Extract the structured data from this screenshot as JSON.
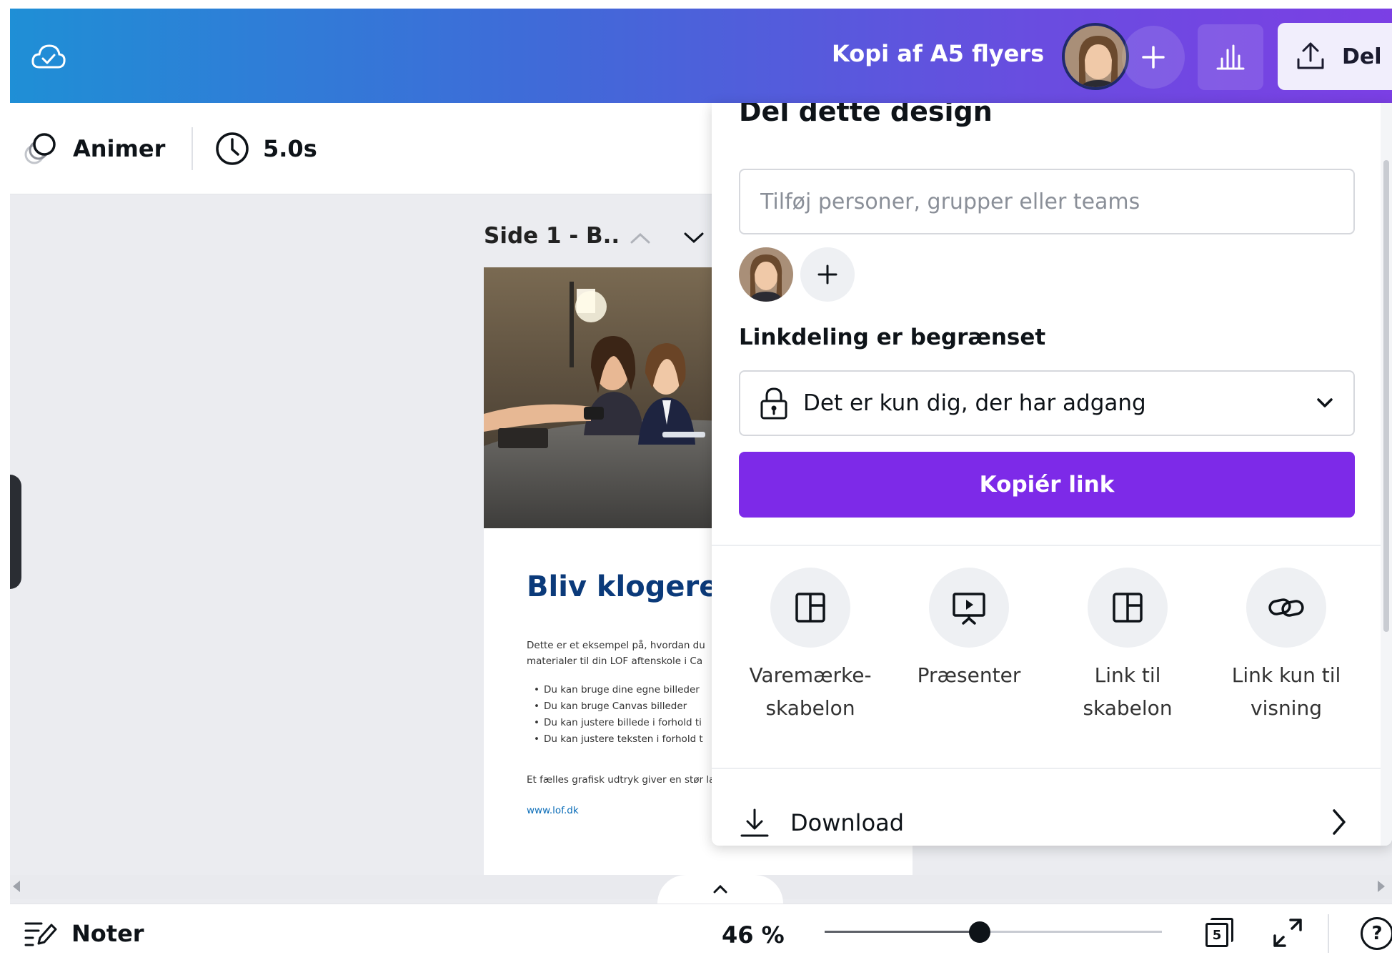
{
  "header": {
    "doc_title": "Kopi af A5 flyers",
    "share_label": "Del"
  },
  "toolbar": {
    "animate_label": "Animer",
    "duration_label": "5.0s"
  },
  "canvas": {
    "page_title": "Side 1 - B..",
    "flyer": {
      "heading": "Bliv klogere i",
      "intro": "Dette er et eksempel på, hvordan du materialer til din LOF aftenskole i Ca",
      "bullets": [
        "Du kan bruge dine egne billeder",
        "Du kan bruge Canvas billeder",
        "Du kan justere billede i forhold ti",
        "Du kan justere teksten i forhold t"
      ],
      "outro": "Et fælles grafisk udtryk giver en stør landet.",
      "url": "www.lof.dk"
    }
  },
  "share_panel": {
    "title": "Del dette design",
    "people_placeholder": "Tilføj personer, grupper eller teams",
    "link_heading": "Linkdeling er begrænset",
    "access_value": "Det er kun dig, der har adgang",
    "copy_link_label": "Kopiér link",
    "options": [
      {
        "label": "Varemærke-\nskabelon",
        "icon": "template-icon"
      },
      {
        "label": "Præsenter",
        "icon": "presentation-icon"
      },
      {
        "label": "Link til\nskabelon",
        "icon": "template-icon"
      },
      {
        "label": "Link kun til\nvisning",
        "icon": "link-icon"
      }
    ],
    "download_label": "Download"
  },
  "bottombar": {
    "notes_label": "Noter",
    "zoom_value": "46 %",
    "zoom_fraction": 0.46,
    "page_count": "5"
  },
  "colors": {
    "accent": "#7d2ae8",
    "header_gradient_start": "#1f8fd6",
    "header_gradient_end": "#7b3fe4"
  }
}
